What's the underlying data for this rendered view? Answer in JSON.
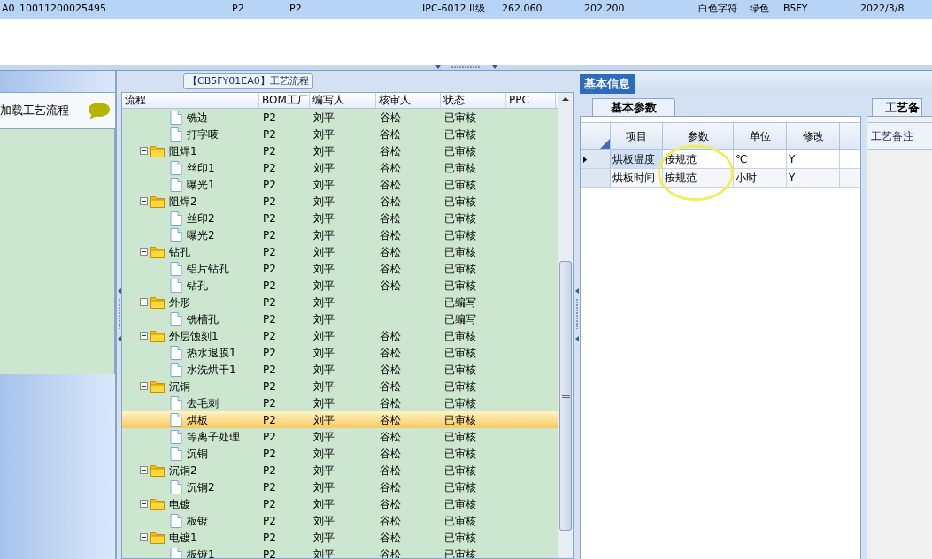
{
  "top_row": {
    "selected": true,
    "cells": [
      "A0",
      "10011200025495",
      "P2",
      "P2",
      "IPC-6012 II级",
      "262.060",
      "202.200",
      "白色字符",
      "绿色",
      "B5FY",
      "2022/3/8"
    ]
  },
  "left_panel": {
    "title": "加载工艺流程"
  },
  "flow": {
    "title": "【CB5FY01EA0】工艺流程",
    "columns": [
      "流程",
      "BOM工厂",
      "编写人",
      "核审人",
      "状态",
      "PPC"
    ],
    "rows": [
      {
        "kind": "file",
        "label": "铣边",
        "bom": "P2",
        "writer": "刘平",
        "reviewer": "谷松",
        "status": "已审核",
        "selected": false
      },
      {
        "kind": "file",
        "label": "打字唛",
        "bom": "P2",
        "writer": "刘平",
        "reviewer": "谷松",
        "status": "已审核",
        "selected": false
      },
      {
        "kind": "folder",
        "label": "阻焊1",
        "bom": "P2",
        "writer": "刘平",
        "reviewer": "谷松",
        "status": "已审核",
        "selected": false,
        "expanded": true,
        "children": [
          {
            "kind": "file",
            "label": "丝印1",
            "bom": "P2",
            "writer": "刘平",
            "reviewer": "谷松",
            "status": "已审核",
            "selected": false
          },
          {
            "kind": "file",
            "label": "曝光1",
            "bom": "P2",
            "writer": "刘平",
            "reviewer": "谷松",
            "status": "已审核",
            "selected": false
          }
        ]
      },
      {
        "kind": "folder",
        "label": "阻焊2",
        "bom": "P2",
        "writer": "刘平",
        "reviewer": "谷松",
        "status": "已审核",
        "selected": false,
        "expanded": true,
        "children": [
          {
            "kind": "file",
            "label": "丝印2",
            "bom": "P2",
            "writer": "刘平",
            "reviewer": "谷松",
            "status": "已审核",
            "selected": false
          },
          {
            "kind": "file",
            "label": "曝光2",
            "bom": "P2",
            "writer": "刘平",
            "reviewer": "谷松",
            "status": "已审核",
            "selected": false
          }
        ]
      },
      {
        "kind": "folder",
        "label": "钻孔",
        "bom": "P2",
        "writer": "刘平",
        "reviewer": "谷松",
        "status": "已审核",
        "selected": false,
        "expanded": true,
        "children": [
          {
            "kind": "file",
            "label": "铝片钻孔",
            "bom": "P2",
            "writer": "刘平",
            "reviewer": "谷松",
            "status": "已审核",
            "selected": false
          },
          {
            "kind": "file",
            "label": "钻孔",
            "bom": "P2",
            "writer": "刘平",
            "reviewer": "谷松",
            "status": "已审核",
            "selected": false
          }
        ]
      },
      {
        "kind": "folder",
        "label": "外形",
        "bom": "P2",
        "writer": "刘平",
        "status": "已编写",
        "selected": false,
        "expanded": true,
        "children": [
          {
            "kind": "file",
            "label": "铣槽孔",
            "bom": "P2",
            "writer": "刘平",
            "status": "已编写",
            "selected": false
          }
        ]
      },
      {
        "kind": "folder",
        "label": "外层蚀刻1",
        "bom": "P2",
        "writer": "刘平",
        "reviewer": "谷松",
        "status": "已审核",
        "selected": false,
        "expanded": true,
        "children": [
          {
            "kind": "file",
            "label": "热水退膜1",
            "bom": "P2",
            "writer": "刘平",
            "reviewer": "谷松",
            "status": "已审核",
            "selected": false
          },
          {
            "kind": "file",
            "label": "水洗烘干1",
            "bom": "P2",
            "writer": "刘平",
            "reviewer": "谷松",
            "status": "已审核",
            "selected": false
          }
        ]
      },
      {
        "kind": "folder",
        "label": "沉铜",
        "bom": "P2",
        "writer": "刘平",
        "reviewer": "谷松",
        "status": "已审核",
        "selected": false,
        "expanded": true,
        "children": [
          {
            "kind": "file",
            "label": "去毛刺",
            "bom": "P2",
            "writer": "刘平",
            "reviewer": "谷松",
            "status": "已审核",
            "selected": false
          },
          {
            "kind": "file",
            "label": "烘板",
            "bom": "P2",
            "writer": "刘平",
            "reviewer": "谷松",
            "status": "已审核",
            "selected": true
          },
          {
            "kind": "file",
            "label": "等离子处理",
            "bom": "P2",
            "writer": "刘平",
            "reviewer": "谷松",
            "status": "已审核",
            "selected": false
          },
          {
            "kind": "file",
            "label": "沉铜",
            "bom": "P2",
            "writer": "刘平",
            "reviewer": "谷松",
            "status": "已审核",
            "selected": false
          }
        ]
      },
      {
        "kind": "folder",
        "label": "沉铜2",
        "bom": "P2",
        "writer": "刘平",
        "reviewer": "谷松",
        "status": "已审核",
        "selected": false,
        "expanded": true,
        "children": [
          {
            "kind": "file",
            "label": "沉铜2",
            "bom": "P2",
            "writer": "刘平",
            "reviewer": "谷松",
            "status": "已审核",
            "selected": false
          }
        ]
      },
      {
        "kind": "folder",
        "label": "电镀",
        "bom": "P2",
        "writer": "刘平",
        "reviewer": "谷松",
        "status": "已审核",
        "selected": false,
        "expanded": true,
        "children": [
          {
            "kind": "file",
            "label": "板镀",
            "bom": "P2",
            "writer": "刘平",
            "reviewer": "谷松",
            "status": "已审核",
            "selected": false
          }
        ]
      },
      {
        "kind": "folder",
        "label": "电镀1",
        "bom": "P2",
        "writer": "刘平",
        "reviewer": "谷松",
        "status": "已审核",
        "selected": false,
        "expanded": true,
        "children": [
          {
            "kind": "file",
            "label": "板镀1",
            "bom": "P2",
            "writer": "刘平",
            "reviewer": "谷松",
            "status": "已审核",
            "selected": false
          }
        ]
      }
    ]
  },
  "info": {
    "tabs": [
      {
        "label": "基本信息",
        "selected": true
      }
    ],
    "sub_tabs": [
      {
        "label": "基本参数",
        "selected": true
      }
    ],
    "columns": [
      "项目",
      "参数",
      "单位",
      "修改"
    ],
    "rows": [
      {
        "item": "烘板温度",
        "param": "按规范",
        "unit": "℃",
        "modify": "Y",
        "selected": true
      },
      {
        "item": "烘板时间",
        "param": "按规范",
        "unit": "小时",
        "modify": "Y",
        "selected": false
      }
    ]
  },
  "notes": {
    "tab": "工艺备",
    "label": "工艺备注"
  }
}
